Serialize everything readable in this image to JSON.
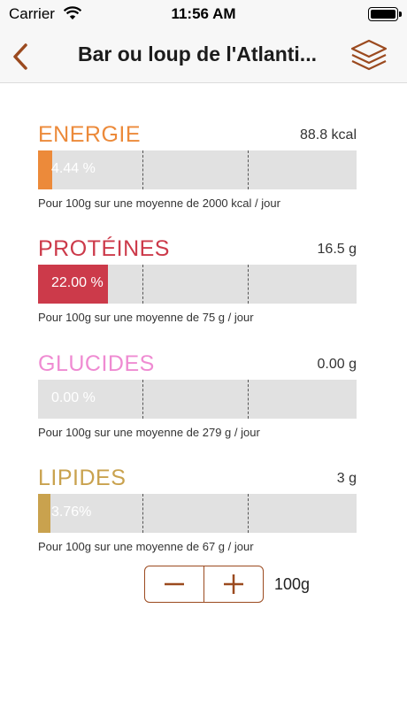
{
  "status_bar": {
    "carrier": "Carrier",
    "time": "11:56 AM"
  },
  "nav": {
    "title": "Bar ou loup de l'Atlanti...",
    "back_icon": "chevron-left-icon",
    "menu_icon": "layers-icon"
  },
  "colors": {
    "accent": "#9b4a1f",
    "energie": "#ec8a3a",
    "proteines": "#cc3a4a",
    "glucides": "#ef8bd2",
    "lipides": "#c9a24e"
  },
  "nutrients": [
    {
      "name": "ENERGIE",
      "value": "88.8 kcal",
      "percent_label": "4.44 %",
      "percent": 4.44,
      "description": "Pour 100g sur une moyenne de 2000 kcal / jour"
    },
    {
      "name": "PROTÉINES",
      "value": "16.5 g",
      "percent_label": "22.00 %",
      "percent": 22.0,
      "description": "Pour 100g sur une moyenne de 75 g / jour"
    },
    {
      "name": "GLUCIDES",
      "value": "0.00 g",
      "percent_label": "0.00 %",
      "percent": 0.0,
      "description": "Pour 100g sur une moyenne de 279 g / jour"
    },
    {
      "name": "LIPIDES",
      "value": "3 g",
      "percent_label": "3.76%",
      "percent": 3.76,
      "description": "Pour 100g sur une moyenne de 67 g / jour"
    }
  ],
  "stepper": {
    "quantity": "100g"
  }
}
